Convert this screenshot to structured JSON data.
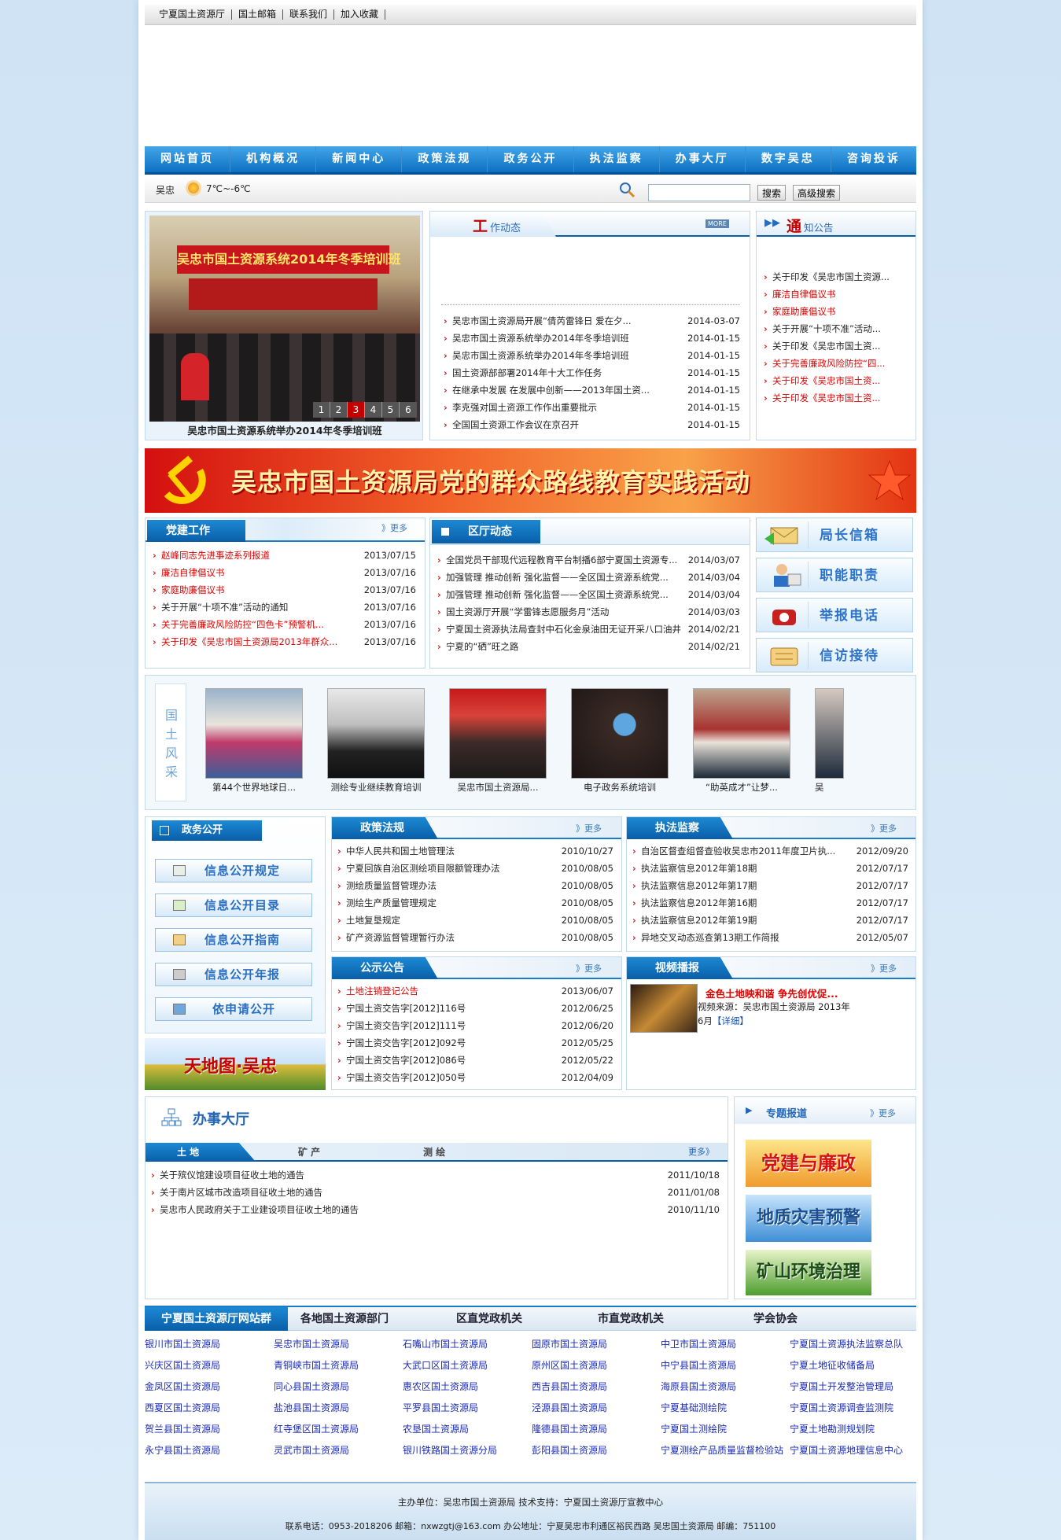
{
  "topbar": {
    "links": [
      "宁夏国土资源厅",
      "国土邮箱",
      "联系我们",
      "加入收藏"
    ]
  },
  "nav": [
    "网站首页",
    "机构概况",
    "新闻中心",
    "政策法规",
    "政务公开",
    "执法监察",
    "办事大厅",
    "数字吴忠",
    "咨询投诉"
  ],
  "weather": {
    "city": "吴忠",
    "temp": "7℃~-6℃"
  },
  "search": {
    "btn": "搜索",
    "adv": "高级搜索",
    "value": ""
  },
  "slider": {
    "caption": "吴忠市国土资源系统举办2014年冬季培训班",
    "banner": "吴忠市国土资源系统2014年冬季培训班",
    "pages": [
      "1",
      "2",
      "3",
      "4",
      "5",
      "6"
    ],
    "active": "3"
  },
  "work": {
    "title_big": "工",
    "title_rest": "作动态",
    "more": "MORE",
    "items": [
      {
        "t": "吴忠市国土资源局开展“倩芮雷锋日 爱在夕...",
        "d": "2014-03-07"
      },
      {
        "t": "吴忠市国土资源系统举办2014年冬季培训班",
        "d": "2014-01-15"
      },
      {
        "t": "吴忠市国土资源系统举办2014年冬季培训班",
        "d": "2014-01-15"
      },
      {
        "t": "国土资源部部署2014年十大工作任务",
        "d": "2014-01-15"
      },
      {
        "t": "在继承中发展 在发展中创新——2013年国土资...",
        "d": "2014-01-15"
      },
      {
        "t": "李克强对国土资源工作作出重要批示",
        "d": "2014-01-15"
      },
      {
        "t": "全国国土资源工作会议在京召开",
        "d": "2014-01-15"
      }
    ]
  },
  "notice": {
    "title_big": "通",
    "title_rest": "知公告",
    "items": [
      {
        "t": "关于印发《吴忠市国土资源...",
        "red": false
      },
      {
        "t": "廉洁自律倡议书",
        "red": true
      },
      {
        "t": "家庭助廉倡议书",
        "red": true
      },
      {
        "t": "关于开展“十项不准”活动...",
        "red": false
      },
      {
        "t": "关于印发《吴忠市国土资...",
        "red": false
      },
      {
        "t": "关于完善廉政风险防控“四...",
        "red": true
      },
      {
        "t": "关于印发《吴忠市国土资...",
        "red": true
      },
      {
        "t": "关于印发《吴忠市国土资...",
        "red": true
      }
    ]
  },
  "banner": {
    "text": "吴忠市国土资源局党的群众路线教育实践活动"
  },
  "party": {
    "title": "党建工作",
    "more": "》更多",
    "items": [
      {
        "t": "赵峰同志先进事迹系列报道",
        "d": "2013/07/15",
        "red": true
      },
      {
        "t": "廉洁自律倡议书",
        "d": "2013/07/16",
        "red": true
      },
      {
        "t": "家庭助廉倡议书",
        "d": "2013/07/16",
        "red": true
      },
      {
        "t": "关于开展“十项不准”活动的通知",
        "d": "2013/07/16",
        "red": false
      },
      {
        "t": "关于完善廉政风险防控“四色卡”预警机...",
        "d": "2013/07/16",
        "red": true
      },
      {
        "t": "关于印发《吴忠市国土资源局2013年群众...",
        "d": "2013/07/16",
        "red": true
      }
    ]
  },
  "district": {
    "title": "区厅动态",
    "items": [
      {
        "t": "全国党员干部现代远程教育平台制播6部宁夏国土资源专...",
        "d": "2014/03/07"
      },
      {
        "t": "加强管理 推动创新 强化监督——全区国土资源系统党...",
        "d": "2014/03/04"
      },
      {
        "t": "加强管理 推动创新 强化监督——全区国土资源系统党...",
        "d": "2014/03/04"
      },
      {
        "t": "国土资源厅开展“学雷锋志愿服务月”活动",
        "d": "2014/03/03"
      },
      {
        "t": "宁夏国土资源执法局查封中石化金泉油田无证开采八口油井",
        "d": "2014/02/21"
      },
      {
        "t": "宁夏的“硒”旺之路",
        "d": "2014/02/21"
      }
    ]
  },
  "services": [
    "局长信箱",
    "职能职责",
    "举报电话",
    "信访接待"
  ],
  "gallery": {
    "label": [
      "国",
      "土",
      "风",
      "采"
    ],
    "items": [
      "第44个世界地球日...",
      "测绘专业继续教育培训",
      "吴忠市国土资源局...",
      "电子政务系统培训",
      "“助英成才”让梦...",
      "吴"
    ]
  },
  "gov": {
    "title": "政务公开",
    "buttons": [
      "信息公开规定",
      "信息公开目录",
      "信息公开指南",
      "信息公开年报",
      "依申请公开"
    ]
  },
  "tianditu": {
    "text": "天地图·吴忠"
  },
  "policy": {
    "title": "政策法规",
    "more": "》更多",
    "items": [
      {
        "t": "中华人民共和国土地管理法",
        "d": "2010/10/27"
      },
      {
        "t": "宁夏回族自治区测绘项目限额管理办法",
        "d": "2010/08/05"
      },
      {
        "t": "测绘质量监督管理办法",
        "d": "2010/08/05"
      },
      {
        "t": "测绘生产质量管理规定",
        "d": "2010/08/05"
      },
      {
        "t": "土地复垦规定",
        "d": "2010/08/05"
      },
      {
        "t": "矿产资源监督管理暂行办法",
        "d": "2010/08/05"
      }
    ]
  },
  "enforce": {
    "title": "执法监察",
    "more": "》更多",
    "items": [
      {
        "t": "自治区督查组督查验收吴忠市2011年度卫片执...",
        "d": "2012/09/20"
      },
      {
        "t": "执法监察信息2012年第18期",
        "d": "2012/07/17"
      },
      {
        "t": "执法监察信息2012年第17期",
        "d": "2012/07/17"
      },
      {
        "t": "执法监察信息2012年第16期",
        "d": "2012/07/17"
      },
      {
        "t": "执法监察信息2012年第19期",
        "d": "2012/07/17"
      },
      {
        "t": "异地交叉动态巡查第13期工作简报",
        "d": "2012/05/07"
      }
    ]
  },
  "public": {
    "title": "公示公告",
    "more": "》更多",
    "items": [
      {
        "t": "土地注销登记公告",
        "d": "2013/06/07",
        "red": true
      },
      {
        "t": "宁国土资交告字[2012]116号",
        "d": "2012/06/25",
        "red": false
      },
      {
        "t": "宁国土资交告字[2012]111号",
        "d": "2012/06/20",
        "red": false
      },
      {
        "t": "宁国土资交告字[2012]092号",
        "d": "2012/05/25",
        "red": false
      },
      {
        "t": "宁国土资交告字[2012]086号",
        "d": "2012/05/22",
        "red": false
      },
      {
        "t": "宁国土资交告字[2012]050号",
        "d": "2012/04/09",
        "red": false
      }
    ]
  },
  "video": {
    "title": "视频播报",
    "more": "》更多",
    "headline": "金色土地映和谐 争先创优促...",
    "source": "视频来源：吴忠市国土资源局 2013年6月",
    "detail": "【详细】"
  },
  "hall": {
    "title": "办事大厅",
    "tabs": [
      "土 地",
      "矿 产",
      "测 绘"
    ],
    "more": "更多》",
    "items": [
      {
        "t": "关于殡仪馆建设项目征收土地的通告",
        "d": "2011/10/18"
      },
      {
        "t": "关于南片区城市改造项目征收土地的通告",
        "d": "2011/01/08"
      },
      {
        "t": "吴忠市人民政府关于工业建设项目征收土地的通告",
        "d": "2010/11/10"
      }
    ]
  },
  "special": {
    "title": "专题报道",
    "more": "》更多",
    "items": [
      "党建与廉政",
      "地质灾害预警",
      "矿山环境治理"
    ]
  },
  "linktabs": [
    "宁夏国土资源厅网站群",
    "各地国土资源部门",
    "区直党政机关",
    "市直党政机关",
    "学会协会"
  ],
  "links": [
    [
      "银川市国土资源局",
      "吴忠市国土资源局",
      "石嘴山市国土资源局",
      "固原市国土资源局",
      "中卫市国土资源局",
      "宁夏国土资源执法监察总队"
    ],
    [
      "兴庆区国土资源局",
      "青铜峡市国土资源局",
      "大武口区国土资源局",
      "原州区国土资源局",
      "中宁县国土资源局",
      "宁夏土地征收储备局"
    ],
    [
      "金凤区国土资源局",
      "同心县国土资源局",
      "惠农区国土资源局",
      "西吉县国土资源局",
      "海原县国土资源局",
      "宁夏国土开发整治管理局"
    ],
    [
      "西夏区国土资源局",
      "盐池县国土资源局",
      "平罗县国土资源局",
      "泾源县国土资源局",
      "宁夏基础测绘院",
      "宁夏国土资源调查监测院"
    ],
    [
      "贺兰县国土资源局",
      "红寺堡区国土资源局",
      "农垦国土资源局",
      "隆德县国土资源局",
      "宁夏国土测绘院",
      "宁夏土地勘测规划院"
    ],
    [
      "永宁县国土资源局",
      "灵武市国土资源局",
      "银川铁路国土资源分局",
      "彭阳县国土资源局",
      "宁夏测绘产品质量监督检验站",
      "宁夏国土资源地理信息中心"
    ]
  ],
  "footer": {
    "line1": "主办单位：吴忠市国土资源局 技术支持：宁夏国土资源厅宣教中心",
    "line2": "联系电话：0953-2018206 邮箱：nxwzgtj@163.com 办公地址：宁夏吴忠市利通区裕民西路 吴忠国土资源局 邮编：751100"
  }
}
